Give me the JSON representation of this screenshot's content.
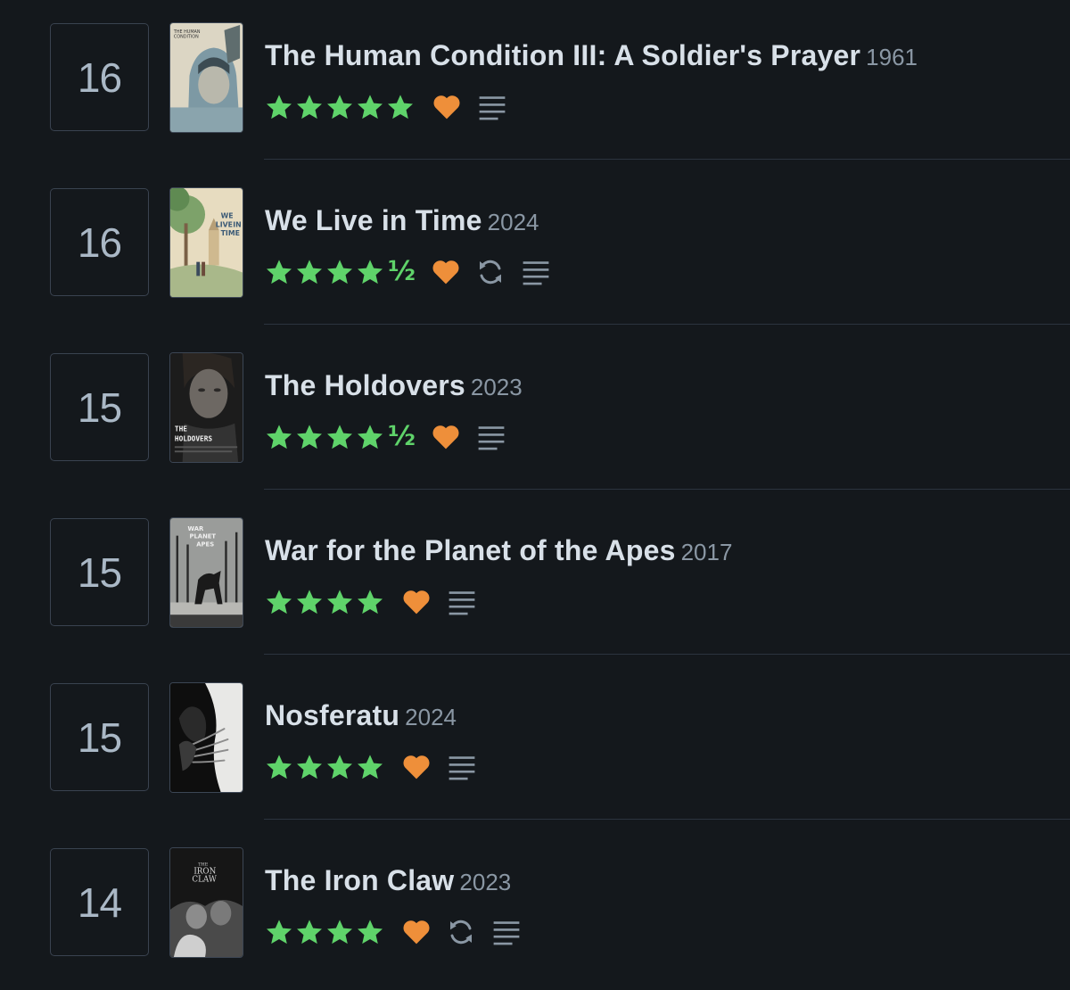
{
  "entries": [
    {
      "rank": "16",
      "title": "The Human Condition III: A Soldier's Prayer",
      "year": "1961",
      "full_stars": 5,
      "half_star": false,
      "liked": true,
      "rewatch": false,
      "review": true,
      "poster": "poster-human-condition",
      "poster_text": [
        "THE HUMAN",
        "CONDITION"
      ]
    },
    {
      "rank": "16",
      "title": "We Live in Time",
      "year": "2024",
      "full_stars": 4,
      "half_star": true,
      "liked": true,
      "rewatch": true,
      "review": true,
      "poster": "poster-we-live-in-time",
      "poster_text": [
        "WE",
        "LIVE",
        "IN",
        "TIME"
      ]
    },
    {
      "rank": "15",
      "title": "The Holdovers",
      "year": "2023",
      "full_stars": 4,
      "half_star": true,
      "liked": true,
      "rewatch": false,
      "review": true,
      "poster": "poster-the-holdovers",
      "poster_text": [
        "THE",
        "HOLDOVERS"
      ]
    },
    {
      "rank": "15",
      "title": "War for the Planet of the Apes",
      "year": "2017",
      "full_stars": 4,
      "half_star": false,
      "liked": true,
      "rewatch": false,
      "review": true,
      "poster": "poster-war-planet-apes",
      "poster_text": [
        "WAR",
        "PLANET",
        "APES"
      ]
    },
    {
      "rank": "15",
      "title": "Nosferatu",
      "year": "2024",
      "full_stars": 4,
      "half_star": false,
      "liked": true,
      "rewatch": false,
      "review": true,
      "poster": "poster-nosferatu",
      "poster_text": []
    },
    {
      "rank": "14",
      "title": "The Iron Claw",
      "year": "2023",
      "full_stars": 4,
      "half_star": false,
      "liked": true,
      "rewatch": true,
      "review": true,
      "poster": "poster-iron-claw",
      "poster_text": [
        "THE",
        "IRON",
        "CLAW"
      ]
    }
  ],
  "half_glyph": "½",
  "colors": {
    "background": "#14181c",
    "star": "#5fd36a",
    "heart": "#ee8f3a",
    "icon": "#8a97a4",
    "title": "#d8e0e8",
    "year": "#8a97a4"
  },
  "icons": {
    "star": "star-icon",
    "half": "half-star-icon",
    "like": "heart-icon",
    "rewatch": "rewatch-icon",
    "review": "review-lines-icon"
  }
}
